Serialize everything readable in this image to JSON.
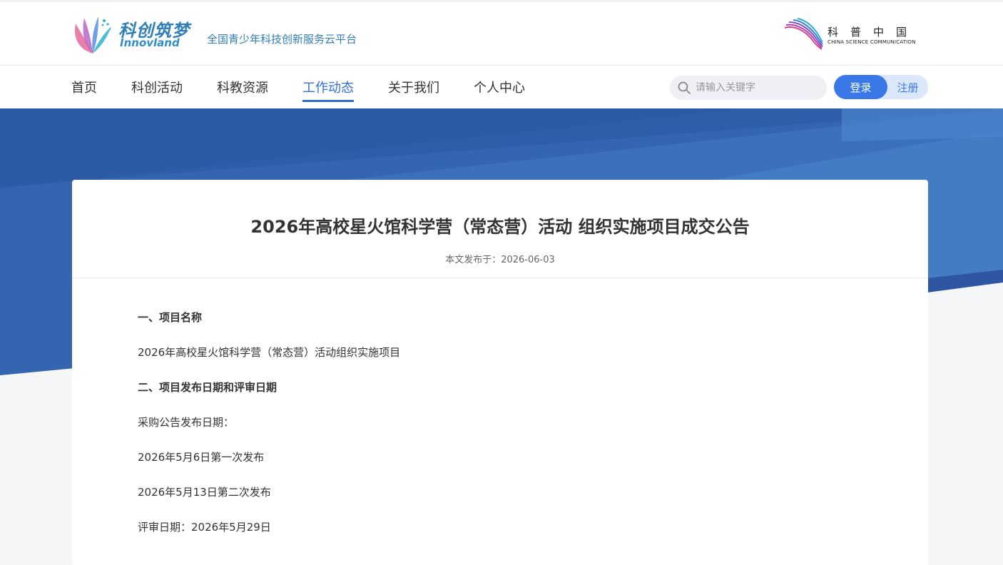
{
  "header": {
    "brand_cn": "科创筑梦",
    "brand_en": "Innovland",
    "slogan": "全国青少年科技创新服务云平台",
    "partner_cn": "科普中国",
    "partner_en": "CHINA SCIENCE COMMUNICATION"
  },
  "nav": {
    "items": [
      {
        "label": "首页"
      },
      {
        "label": "科创活动"
      },
      {
        "label": "科教资源"
      },
      {
        "label": "工作动态"
      },
      {
        "label": "关于我们"
      },
      {
        "label": "个人中心"
      }
    ],
    "active_index": 3,
    "search_placeholder": "请输入关键字",
    "login_label": "登录",
    "register_label": "注册"
  },
  "article": {
    "title": "2026年高校星火馆科学营（常态营）活动 组织实施项目成交公告",
    "meta": "本文发布于：2026-06-03",
    "paragraphs": [
      {
        "text": "一、项目名称",
        "bold": true
      },
      {
        "text": "2026年高校星火馆科学营（常态营）活动组织实施项目",
        "bold": false
      },
      {
        "text": "二、项目发布日期和评审日期",
        "bold": true
      },
      {
        "text": "采购公告发布日期：",
        "bold": false
      },
      {
        "text": "2026年5月6日第一次发布",
        "bold": false
      },
      {
        "text": "2026年5月13日第二次发布",
        "bold": false
      },
      {
        "text": "评审日期：2026年5月29日",
        "bold": false
      }
    ]
  },
  "colors": {
    "accent": "#2f6fd6",
    "brand": "#2f7fb8",
    "banner_dark": "#2f5ea8",
    "banner_light": "#4a86cc"
  }
}
